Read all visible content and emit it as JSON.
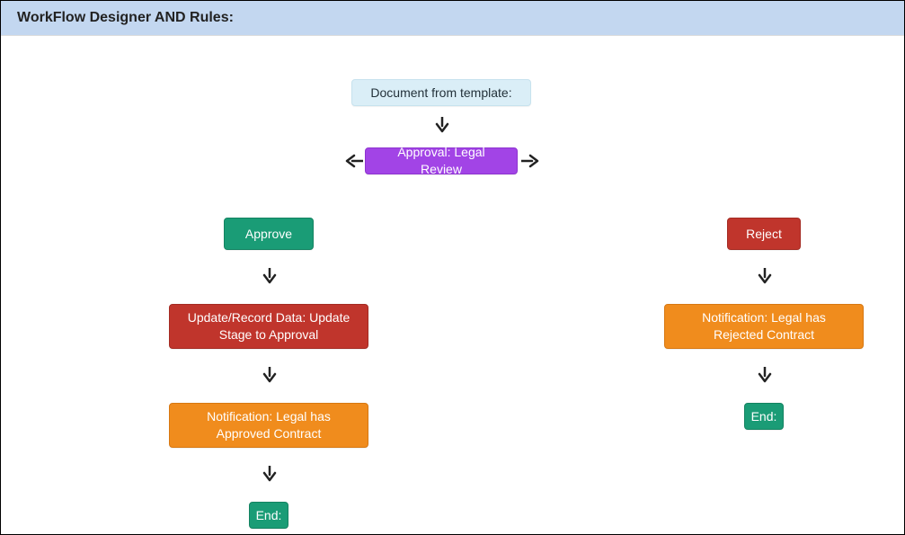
{
  "header": {
    "title": "WorkFlow Designer AND Rules:"
  },
  "nodes": {
    "template": "Document from template:",
    "approval": "Approval: Legal Review",
    "approve": "Approve",
    "reject": "Reject",
    "update": "Update/Record Data: Update Stage to Approval",
    "notifApprove": "Notification: Legal has Approved Contract",
    "notifReject": "Notification: Legal has Rejected Contract",
    "endLeft": "End:",
    "endRight": "End:"
  }
}
